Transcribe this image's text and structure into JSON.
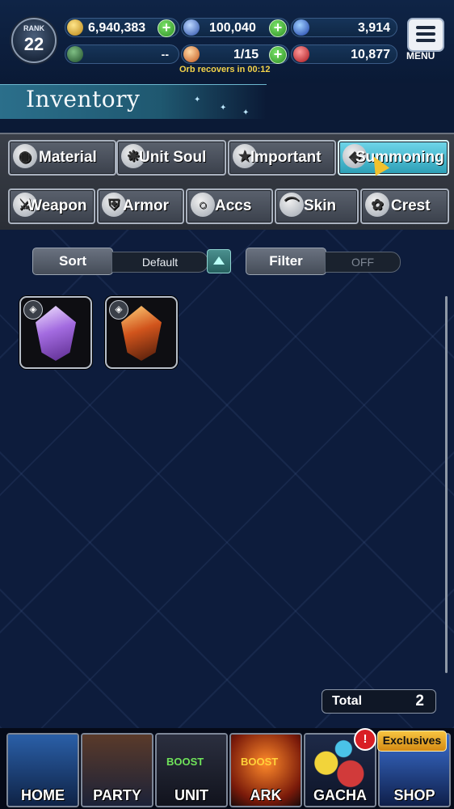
{
  "header": {
    "rank_label": "RANK",
    "rank_value": "22",
    "gold": "6,940,383",
    "lapis": "100,040",
    "blue_orbs": "3,914",
    "guild_value": "--",
    "orbs": "1/15",
    "red_gems": "10,877",
    "orb_timer": "Orb recovers in 00:12",
    "menu_label": "MENU"
  },
  "page": {
    "title": "Inventory"
  },
  "tabs": {
    "row1": [
      {
        "label": "Material",
        "icon": "bag-icon"
      },
      {
        "label": "Unit Soul",
        "icon": "soul-icon"
      },
      {
        "label": "Important",
        "icon": "star-icon"
      },
      {
        "label": "Summoning",
        "icon": "summon-icon",
        "active": true
      }
    ],
    "row2": [
      {
        "label": "Weapon",
        "icon": "sword-icon"
      },
      {
        "label": "Armor",
        "icon": "armor-icon"
      },
      {
        "label": "Accs",
        "icon": "ring-icon"
      },
      {
        "label": "Skin",
        "icon": "hanger-icon"
      },
      {
        "label": "Crest",
        "icon": "crest-icon"
      }
    ]
  },
  "controls": {
    "sort_label": "Sort",
    "sort_value": "Default",
    "filter_label": "Filter",
    "filter_value": "OFF"
  },
  "items": [
    {
      "name": "summon-crystal-violet",
      "colors": [
        "#f2e6ff",
        "#a36be0",
        "#5a2a8c"
      ]
    },
    {
      "name": "summon-crystal-fire",
      "colors": [
        "#ffd27a",
        "#d1541c",
        "#4a1a0a"
      ]
    }
  ],
  "total": {
    "label": "Total",
    "value": "2"
  },
  "nav": {
    "home": "HOME",
    "party": "PARTY",
    "unit": "UNIT",
    "unit_boost": "BOOST",
    "ark": "ARK",
    "ark_boost": "BOOST",
    "gacha": "GACHA",
    "gacha_alert": "!",
    "shop": "SHOP",
    "shop_badge": "Exclusives"
  }
}
